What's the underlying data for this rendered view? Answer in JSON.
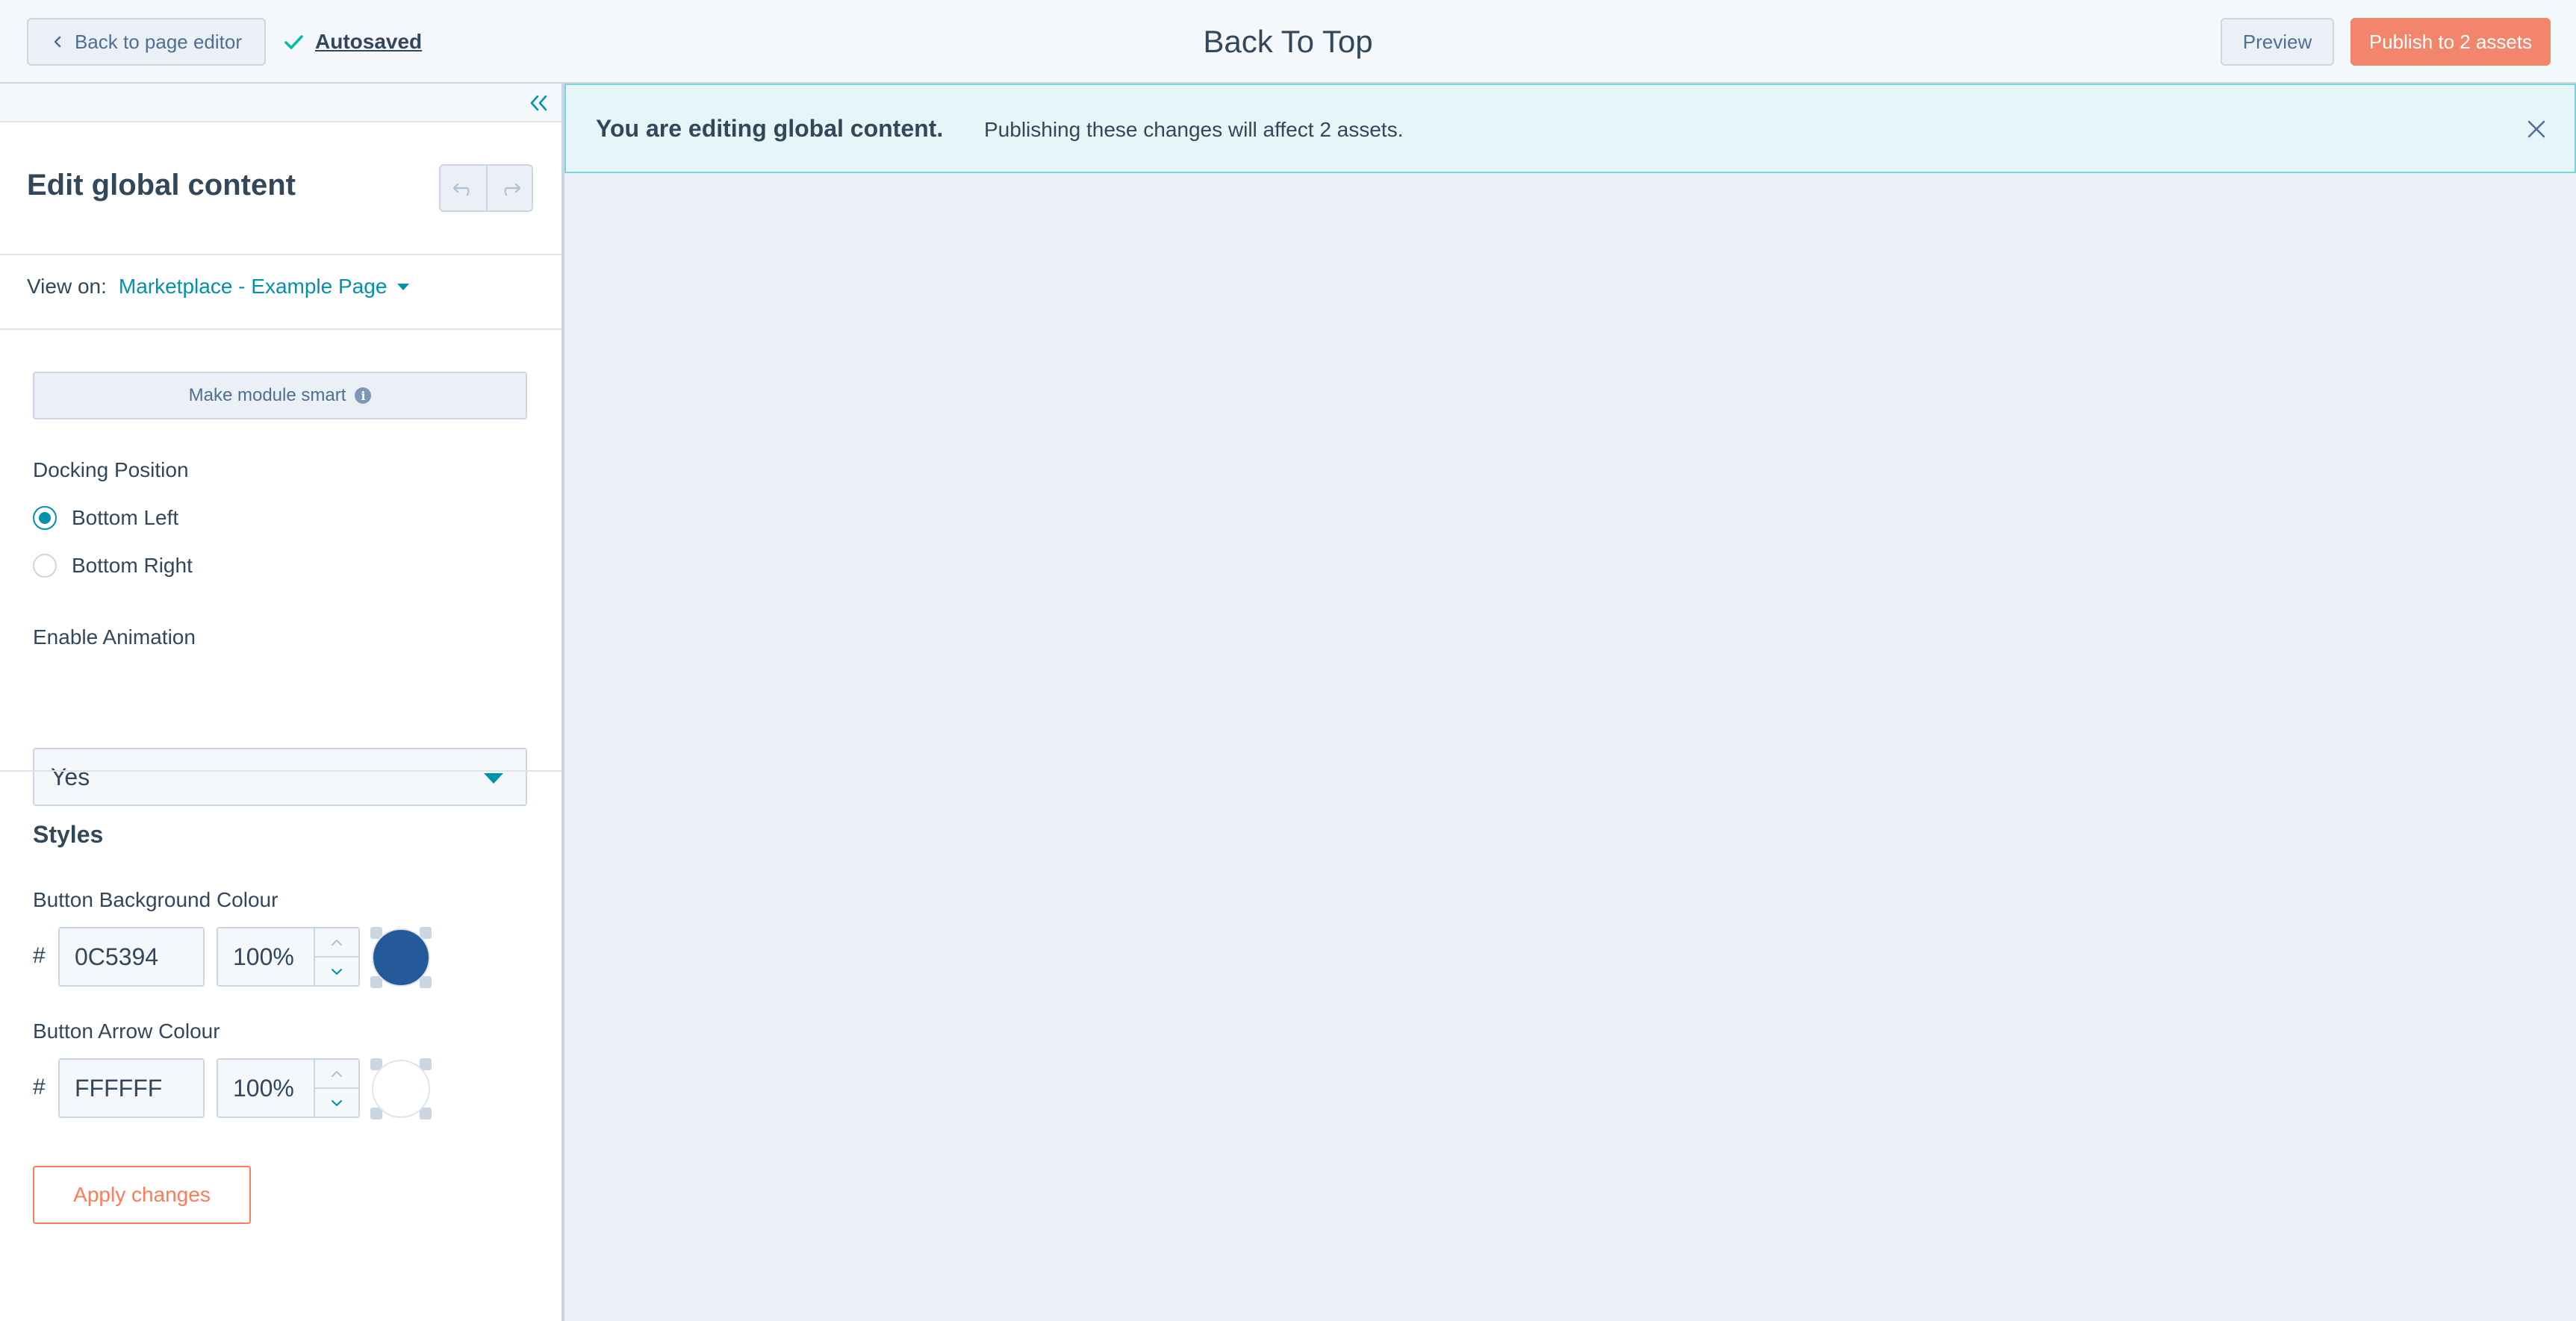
{
  "header": {
    "back_label": "Back to page editor",
    "autosaved_label": "Autosaved",
    "title": "Back To Top",
    "preview_label": "Preview",
    "publish_label": "Publish to 2 assets"
  },
  "sidebar": {
    "title": "Edit global content",
    "view_on_label": "View on:",
    "view_on_value": "Marketplace - Example Page",
    "smart_label": "Make module smart",
    "info_glyph": "i",
    "docking": {
      "label": "Docking Position",
      "options": [
        "Bottom Left",
        "Bottom Right"
      ],
      "selected": "Bottom Left"
    },
    "animation": {
      "label": "Enable Animation",
      "value": "Yes"
    },
    "styles_heading": "Styles",
    "bg_colour": {
      "label": "Button Background Colour",
      "hash": "#",
      "hex": "0C5394",
      "opacity": "100%",
      "swatch": "#245a9a"
    },
    "arrow_colour": {
      "label": "Button Arrow Colour",
      "hash": "#",
      "hex": "FFFFFF",
      "opacity": "100%",
      "swatch": "#ffffff"
    },
    "apply_label": "Apply changes"
  },
  "banner": {
    "strong": "You are editing global content.",
    "text": "Publishing these changes will affect 2 assets."
  },
  "colors": {
    "accent": "#0091ae",
    "publish": "#f2856b",
    "apply": "#ff7a59",
    "success": "#00bda5"
  },
  "icons": {
    "back": "chevron-left-icon",
    "autosaved": "check-icon",
    "collapse": "double-chevron-left-icon",
    "undo": "undo-icon",
    "redo": "redo-icon",
    "view_on_caret": "caret-down-icon",
    "info": "info-icon",
    "select_caret": "caret-down-icon",
    "step_up": "chevron-up-icon",
    "step_down": "chevron-down-icon",
    "banner_close": "close-icon"
  }
}
